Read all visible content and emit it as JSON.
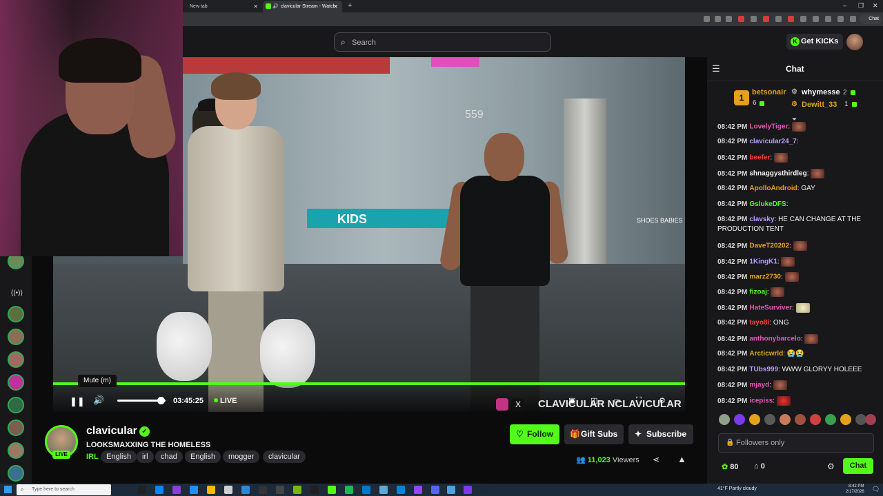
{
  "browser": {
    "tabs": [
      {
        "title": "New tab"
      },
      {
        "title": "clavicular Stream - Watch Live"
      }
    ],
    "new_tab_symbol": "+",
    "close_symbol": "✕",
    "chat_pill_label": "Chat"
  },
  "header": {
    "search_placeholder": "Search",
    "get_kicks_label": "Get KICKs"
  },
  "player": {
    "tooltip": "Mute (m)",
    "elapsed": "03:45:25",
    "live_label": "LIVE",
    "volume_fraction": 0.9,
    "watermark_text": "CLAVICULAR NCLAVICULAR"
  },
  "video_scene": {
    "sign_kids": "KIDS",
    "sign_number": "559",
    "sign_shoes": "SHOES BABIES"
  },
  "stream": {
    "streamer": "clavicular",
    "live_badge": "LIVE",
    "title": "LOOKSMAXXING THE HOMELESS",
    "category": "IRL",
    "tags": [
      "English",
      "irl",
      "chad",
      "English",
      "mogger",
      "clavicular"
    ],
    "follow_label": "Follow",
    "gift_label": "Gift Subs",
    "subscribe_label": "Subscribe",
    "viewer_count": "11,023",
    "viewer_suffix": "Viewers"
  },
  "chat": {
    "title": "Chat",
    "top_gifters": [
      {
        "rank": "1",
        "name": "betsonair",
        "count": "6",
        "color": "#e4a11b"
      },
      {
        "rank": "",
        "name": "whymesse",
        "count": "2",
        "color": "#ffffff"
      },
      {
        "rank": "",
        "name": "Dewitt_33",
        "count": "1",
        "color": "#e4a11b"
      }
    ],
    "messages": [
      {
        "time": "08:42 PM",
        "user": "LovelyTiger",
        "color": "#e05ab4",
        "text": "",
        "emote": "face"
      },
      {
        "time": "08:42 PM",
        "user": "clavicular24_7",
        "color": "#b59cff",
        "text": "",
        "emote": ""
      },
      {
        "time": "08:42 PM",
        "user": "beefer",
        "color": "#ff3b3b",
        "text": "",
        "emote": "face"
      },
      {
        "time": "08:42 PM",
        "user": "shnaggysthirdleg",
        "color": "#f2f2f2",
        "text": "",
        "emote": "face"
      },
      {
        "time": "08:42 PM",
        "user": "ApolloAndroid",
        "color": "#e4a11b",
        "text": "GAY",
        "emote": ""
      },
      {
        "time": "08:42 PM",
        "user": "GslukeDFS",
        "color": "#53fc18",
        "text": "",
        "emote": ""
      },
      {
        "time": "08:42 PM",
        "user": "clavsky",
        "color": "#b59cff",
        "text": "HE CAN CHANGE AT THE PRODUCTION TENT",
        "emote": ""
      },
      {
        "time": "08:42 PM",
        "user": "DaveT20202",
        "color": "#e4a11b",
        "text": "",
        "emote": "face"
      },
      {
        "time": "08:42 PM",
        "user": "1KingK1",
        "color": "#b59cff",
        "text": "",
        "emote": "face"
      },
      {
        "time": "08:42 PM",
        "user": "marz2730",
        "color": "#e4a11b",
        "text": "",
        "emote": "face"
      },
      {
        "time": "08:42 PM",
        "user": "fizoaj",
        "color": "#53fc18",
        "text": "",
        "emote": "face"
      },
      {
        "time": "08:42 PM",
        "user": "HateSurviver",
        "color": "#e05ab4",
        "text": "",
        "emote": "pale"
      },
      {
        "time": "08:42 PM",
        "user": "tayo8i",
        "color": "#ff3b3b",
        "text": "ONG",
        "emote": ""
      },
      {
        "time": "08:42 PM",
        "user": "anthonybarcelo",
        "color": "#e05ab4",
        "text": "",
        "emote": "face"
      },
      {
        "time": "08:42 PM",
        "user": "Arcticwrld",
        "color": "#e4a11b",
        "text": "😭😭",
        "emote": ""
      },
      {
        "time": "08:42 PM",
        "user": "TUbs999",
        "color": "#b59cff",
        "text": "WWW GLORYY HOLEEE",
        "emote": ""
      },
      {
        "time": "08:42 PM",
        "user": "mjayd",
        "color": "#e05ab4",
        "text": "",
        "emote": "face"
      },
      {
        "time": "08:42 PM",
        "user": "icepiss",
        "color": "#e05ab4",
        "text": "",
        "emote": "red"
      }
    ],
    "input_placeholder": "Followers only",
    "kicks_balance": "80",
    "store_count": "0",
    "send_label": "Chat"
  },
  "taskbar": {
    "search_placeholder": "Type here to search",
    "weather": "41°F  Partly cloudy",
    "time": "8:42 PM",
    "date": "2/17/2026"
  },
  "colors": {
    "accent": "#53fc18",
    "panel": "#18181b",
    "background": "#0b0b0c"
  }
}
